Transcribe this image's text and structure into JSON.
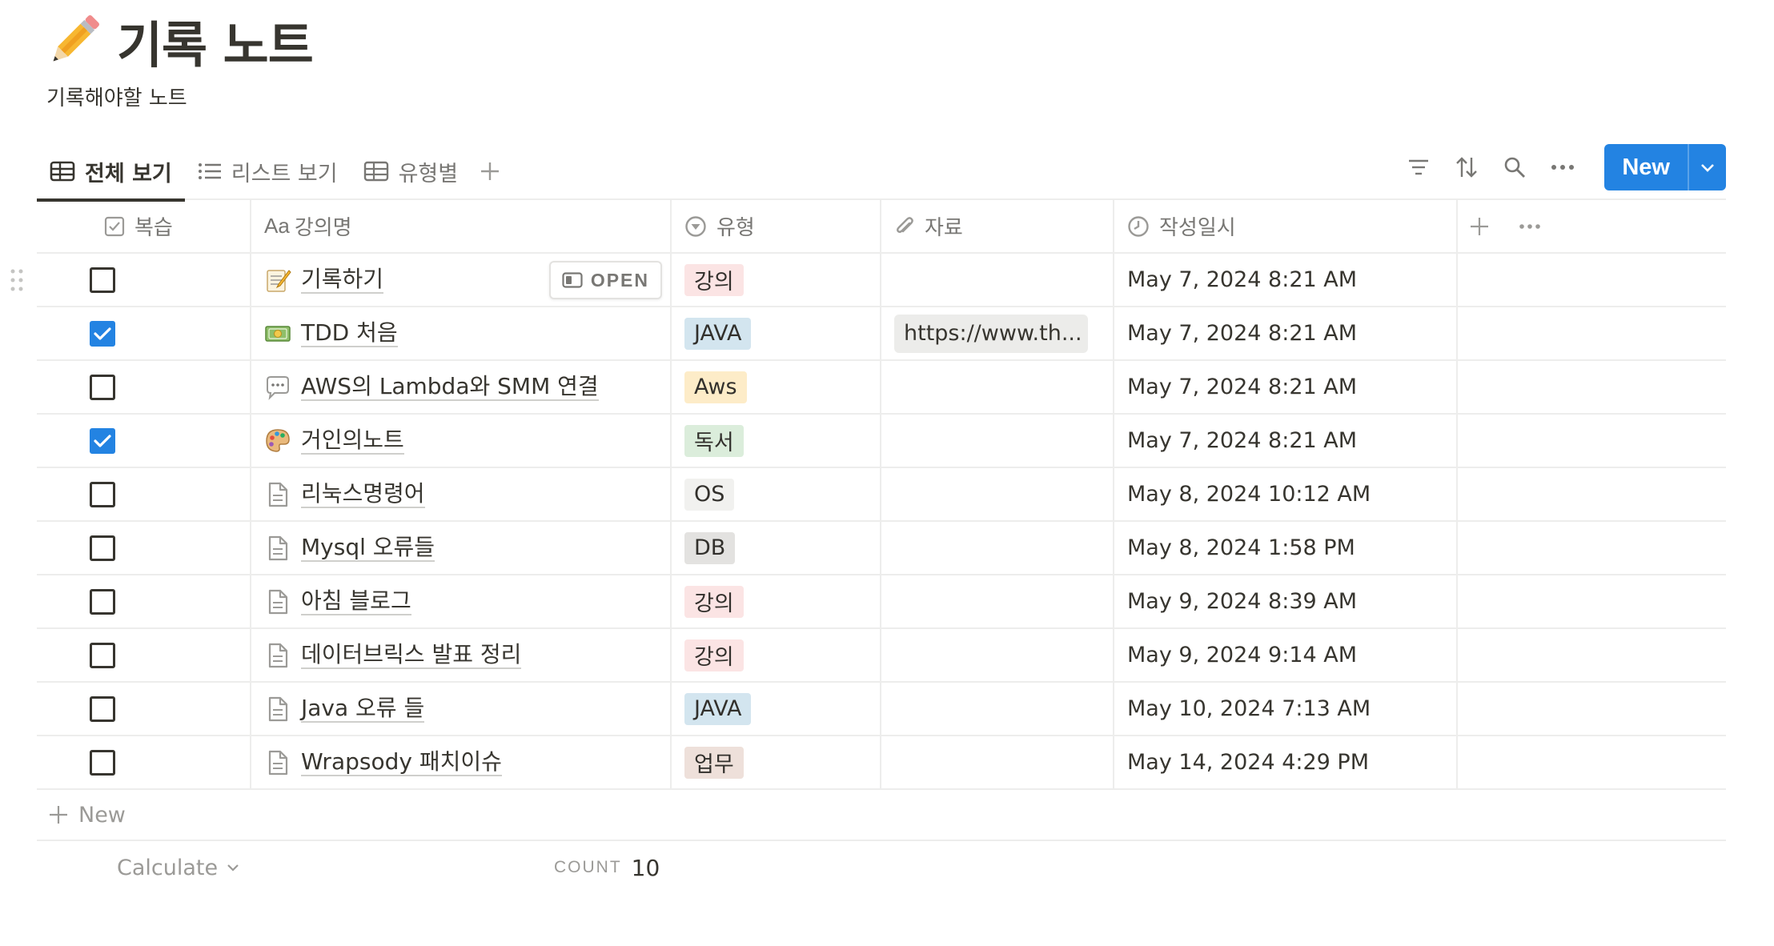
{
  "page": {
    "icon": "pencil-icon",
    "title": "기록 노트",
    "description": "기록해야할 노트"
  },
  "views": {
    "tabs": [
      {
        "label": "전체 보기",
        "icon": "table-icon",
        "active": true
      },
      {
        "label": "리스트 보기",
        "icon": "list-icon",
        "active": false
      },
      {
        "label": "유형별",
        "icon": "table-icon",
        "active": false
      }
    ],
    "add_view": "plus-icon"
  },
  "toolbar": {
    "icons": [
      "filter-icon",
      "sort-icon",
      "search-icon",
      "more-icon"
    ],
    "new_label": "New",
    "accent": "#2383e2"
  },
  "columns": {
    "check": {
      "label": "복습",
      "icon": "checkbox-icon"
    },
    "name": {
      "prefix": "Aa",
      "label": "강의명"
    },
    "type": {
      "label": "유형",
      "icon": "select-icon"
    },
    "file": {
      "label": "자료",
      "icon": "paperclip-icon"
    },
    "date": {
      "label": "작성일시",
      "icon": "clock-icon"
    }
  },
  "open_label": "OPEN",
  "rows": [
    {
      "checked": false,
      "icon": "memo-icon",
      "name": "기록하기",
      "type": "강의",
      "type_color": "#fbe4e4",
      "file": "",
      "date": "May 7, 2024 8:21 AM"
    },
    {
      "checked": true,
      "icon": "money-icon",
      "name": "TDD 처음",
      "type": "JAVA",
      "type_color": "#d3e5ef",
      "file": "https://www.th...",
      "date": "May 7, 2024 8:21 AM"
    },
    {
      "checked": false,
      "icon": "speech-bubble-icon",
      "name": "AWS의 Lambda와 SMM 연결",
      "type": "Aws",
      "type_color": "#fdecc8",
      "file": "",
      "date": "May 7, 2024 8:21 AM"
    },
    {
      "checked": true,
      "icon": "palette-icon",
      "name": "거인의노트",
      "type": "독서",
      "type_color": "#dbeddb",
      "file": "",
      "date": "May 7, 2024 8:21 AM"
    },
    {
      "checked": false,
      "icon": "document-icon",
      "name": "리눅스명령어",
      "type": "OS",
      "type_color": "#f1f1ef",
      "file": "",
      "date": "May 8, 2024 10:12 AM"
    },
    {
      "checked": false,
      "icon": "document-icon",
      "name": "Mysql 오류들",
      "type": "DB",
      "type_color": "#e3e2e0",
      "file": "",
      "date": "May 8, 2024 1:58 PM"
    },
    {
      "checked": false,
      "icon": "document-icon",
      "name": "아침 블로그",
      "type": "강의",
      "type_color": "#fbe4e4",
      "file": "",
      "date": "May 9, 2024 8:39 AM"
    },
    {
      "checked": false,
      "icon": "document-icon",
      "name": "데이터브릭스 발표 정리",
      "type": "강의",
      "type_color": "#fbe4e4",
      "file": "",
      "date": "May 9, 2024 9:14 AM"
    },
    {
      "checked": false,
      "icon": "document-icon",
      "name": "Java 오류 들",
      "type": "JAVA",
      "type_color": "#d3e5ef",
      "file": "",
      "date": "May 10, 2024 7:13 AM"
    },
    {
      "checked": false,
      "icon": "document-icon",
      "name": "Wrapsody 패치이슈",
      "type": "업무",
      "type_color": "#eee0da",
      "file": "",
      "date": "May 14, 2024 4:29 PM"
    }
  ],
  "new_row_label": "New",
  "footer": {
    "calculate_label": "Calculate",
    "count_label": "COUNT",
    "count_value": "10"
  }
}
